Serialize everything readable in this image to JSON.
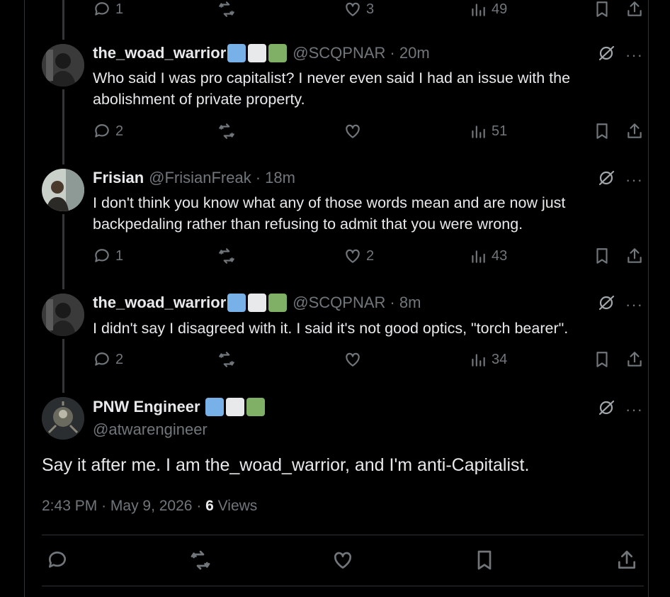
{
  "replies": [
    {
      "id": "top-partial",
      "stats": {
        "reply": "1",
        "retweet": "",
        "like": "3",
        "views": "49"
      }
    },
    {
      "id": "r1",
      "name": "the_woad_warrior",
      "badges": [
        "#78b0e8",
        "#e7e9ea",
        "#7fb065"
      ],
      "handle": "@SCQPNAR",
      "time": "· 20m",
      "text": "Who said I was pro capitalist? I never even said I had an issue with the abolishment of private property.",
      "stats": {
        "reply": "2",
        "retweet": "",
        "like": "",
        "views": "51"
      }
    },
    {
      "id": "r2",
      "name": "Frisian",
      "badges": [],
      "handle": "@FrisianFreak",
      "time": "· 18m",
      "text": "I don't think you know what any of those words mean and are now just backpedaling rather than refusing to admit that you were wrong.",
      "stats": {
        "reply": "1",
        "retweet": "",
        "like": "2",
        "views": "43"
      }
    },
    {
      "id": "r3",
      "name": "the_woad_warrior",
      "badges": [
        "#78b0e8",
        "#e7e9ea",
        "#7fb065"
      ],
      "handle": "@SCQPNAR",
      "time": "· 8m",
      "text": "I didn't say I disagreed with it. I said it's not good optics, \"torch bearer\".",
      "stats": {
        "reply": "2",
        "retweet": "",
        "like": "",
        "views": "34"
      }
    }
  ],
  "main": {
    "name": "PNW Engineer",
    "badges": [
      "#78b0e8",
      "#e7e9ea",
      "#7fb065"
    ],
    "handle": "@atwarengineer",
    "text": "Say it after me. I am the_woad_warrior, and I'm anti-Capitalist.",
    "time": "2:43 PM",
    "date": "May 9, 2026",
    "views_count": "6",
    "views_label": "Views"
  },
  "icons": {
    "reply": "reply-icon",
    "retweet": "retweet-icon",
    "like": "heart-icon",
    "views": "views-icon",
    "bookmark": "bookmark-icon",
    "share": "share-icon",
    "grok": "grok-icon",
    "more": "more-icon"
  },
  "more_glyph": "···"
}
